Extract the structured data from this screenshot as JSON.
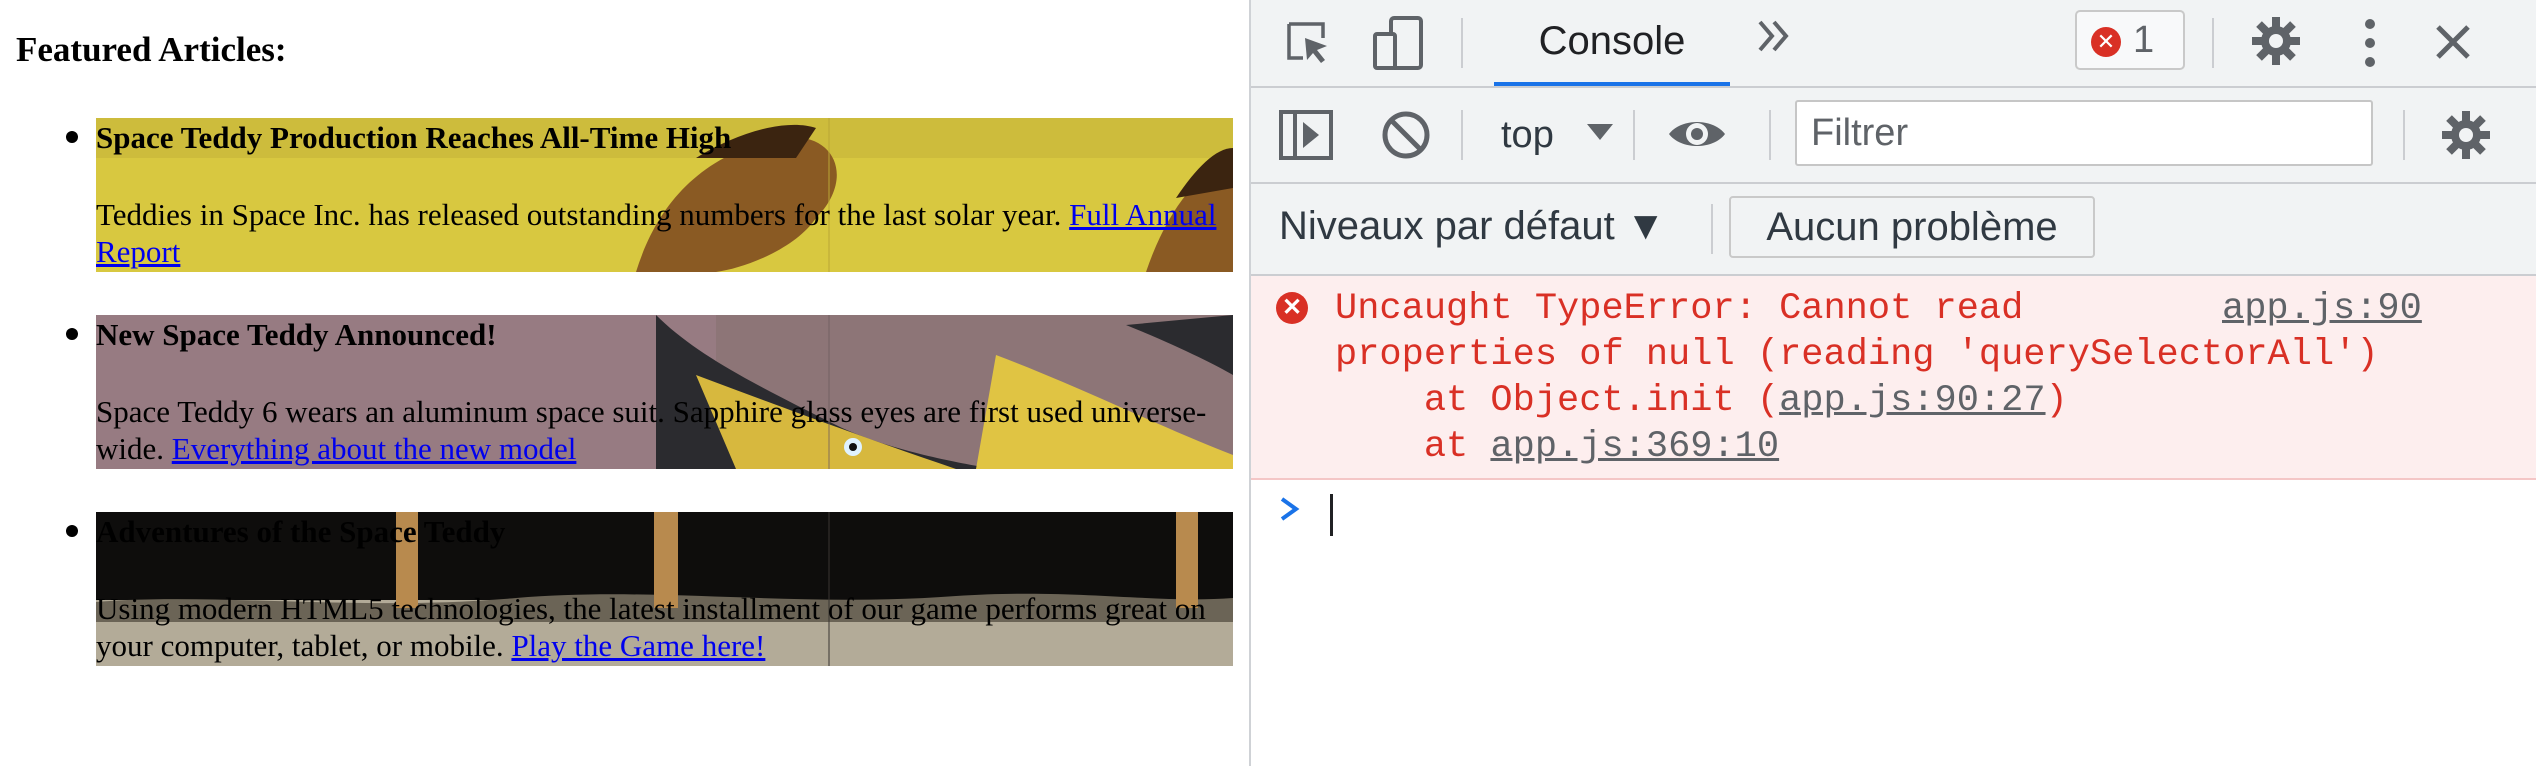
{
  "page": {
    "heading": "Featured Articles:",
    "articles": [
      {
        "title": "Space Teddy Production Reaches All-Time High",
        "body": "Teddies in Space Inc. has released outstanding numbers for the last solar year.",
        "link": "Full Annual Report"
      },
      {
        "title": "New Space Teddy Announced!",
        "body": "Space Teddy 6 wears an aluminum space suit. Sapphire glass eyes are first used universe-wide.",
        "link": "Everything about the new model"
      },
      {
        "title": "Adventures of the Space Teddy",
        "body": "Using modern HTML5 technologies, the latest installment of our game performs great on your computer, tablet, or mobile.",
        "link": "Play the Game here!"
      }
    ]
  },
  "devtools": {
    "tabs": {
      "active": "Console",
      "more_icon": "double-chevron-right-icon"
    },
    "error_count": "1",
    "toolbar": {
      "context": "top",
      "filter_placeholder": "Filtrer",
      "levels": "Niveaux par défaut ▼",
      "issues": "Aucun problème"
    },
    "console": {
      "error": {
        "line1": "Uncaught TypeError: Cannot read",
        "line2": "properties of null (reading 'querySelectorAll')",
        "line3_prefix": "    at Object.init (",
        "line3_link": "app.js:90:27",
        "line3_suffix": ")",
        "line4_prefix": "    at ",
        "line4_link": "app.js:369:10",
        "source": "app.js:90"
      }
    },
    "colors": {
      "accent": "#1a73e8",
      "error": "#d93025",
      "error_bg": "#fdeeee"
    }
  }
}
